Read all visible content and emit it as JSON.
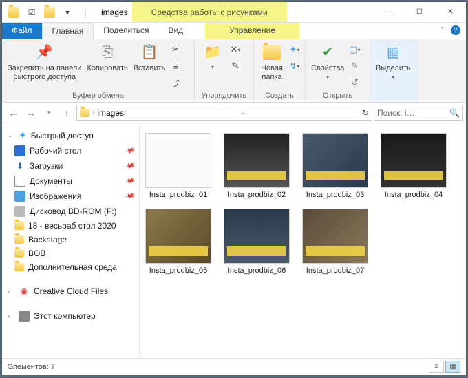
{
  "title": {
    "folder_name": "images",
    "context_tab": "Средства работы с рисунками"
  },
  "tabs": {
    "file": "Файл",
    "home": "Главная",
    "share": "Поделиться",
    "view": "Вид",
    "manage": "Управление"
  },
  "ribbon": {
    "clipboard": {
      "pin": "Закрепить на панели\nбыстрого доступа",
      "copy": "Копировать",
      "paste": "Вставить",
      "group": "Буфер обмена"
    },
    "organize": {
      "group": "Упорядочить"
    },
    "new": {
      "newfolder": "Новая\nпапка",
      "group": "Создать"
    },
    "open": {
      "properties": "Свойства",
      "group": "Открыть"
    },
    "select": {
      "select": "Выделить",
      "group": ""
    }
  },
  "nav": {
    "crumb": "images",
    "search_placeholder": "Поиск: i…"
  },
  "sidebar": {
    "quick": "Быстрый доступ",
    "items": [
      {
        "label": "Рабочий стол"
      },
      {
        "label": "Загрузки"
      },
      {
        "label": "Документы"
      },
      {
        "label": "Изображения"
      },
      {
        "label": "Дисковод BD-ROM (F:)"
      },
      {
        "label": "18 - весьраб стол 2020"
      },
      {
        "label": "Backstage"
      },
      {
        "label": "BOB"
      },
      {
        "label": "Дополнительная среда"
      }
    ],
    "cc": "Creative Cloud Files",
    "pc": "Этот компьютер"
  },
  "files": [
    {
      "name": "Insta_prodbiz_01"
    },
    {
      "name": "Insta_prodbiz_02"
    },
    {
      "name": "Insta_prodbiz_03"
    },
    {
      "name": "Insta_prodbiz_04"
    },
    {
      "name": "Insta_prodbiz_05"
    },
    {
      "name": "Insta_prodbiz_06"
    },
    {
      "name": "Insta_prodbiz_07"
    }
  ],
  "status": {
    "count": "Элементов: 7"
  }
}
